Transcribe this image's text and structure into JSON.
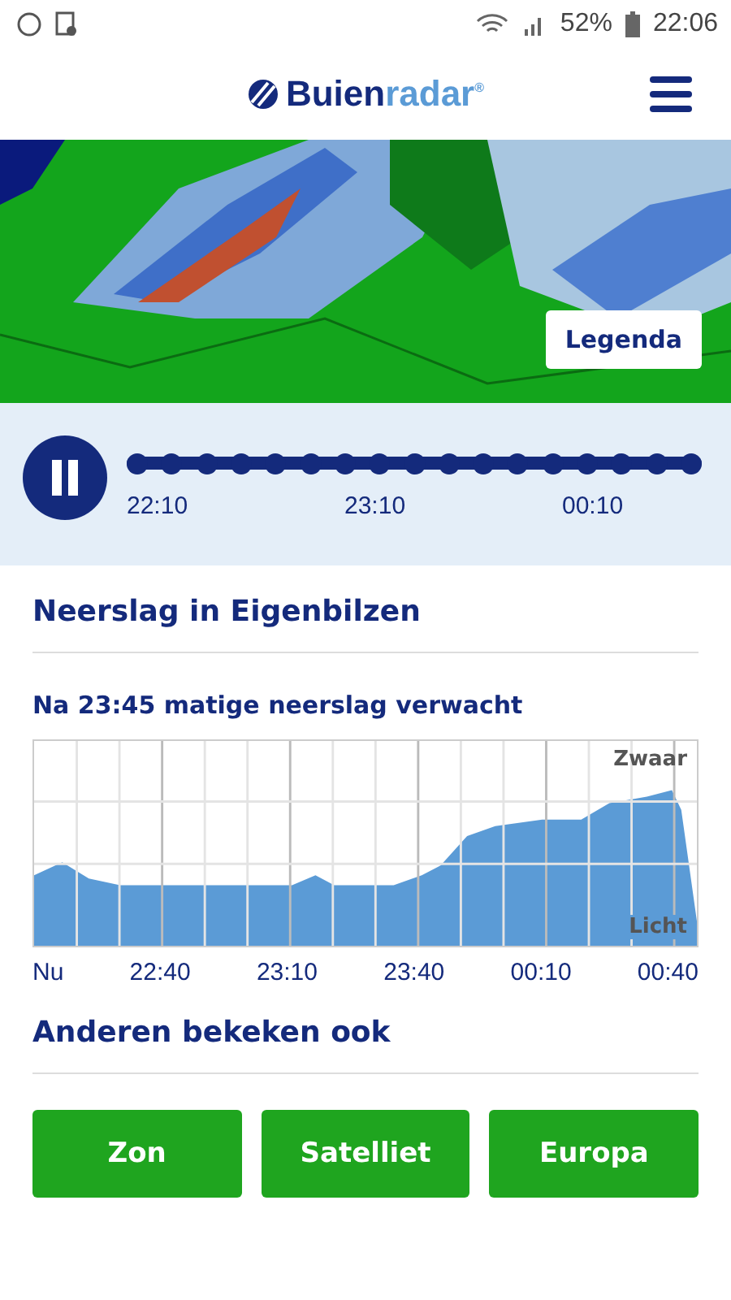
{
  "status_bar": {
    "battery": "52%",
    "time": "22:06"
  },
  "header": {
    "logo_bold": "Buien",
    "logo_light": "radar",
    "logo_mark": "®"
  },
  "map": {
    "legend_button": "Legenda"
  },
  "player": {
    "playing": true,
    "level": 1,
    "times": [
      "22:10",
      "23:10",
      "00:10"
    ]
  },
  "location": {
    "title": "Neerslag in Eigenbilzen"
  },
  "forecast": {
    "summary": "Na 23:45 matige neerslag verwacht",
    "top_label": "Zwaar",
    "bottom_label": "Licht",
    "x_labels": [
      "Nu",
      "22:40",
      "23:10",
      "23:40",
      "00:10",
      "00:40"
    ]
  },
  "related": {
    "title": "Anderen bekeken ook",
    "buttons": [
      "Zon",
      "Satelliet",
      "Europa"
    ]
  }
}
